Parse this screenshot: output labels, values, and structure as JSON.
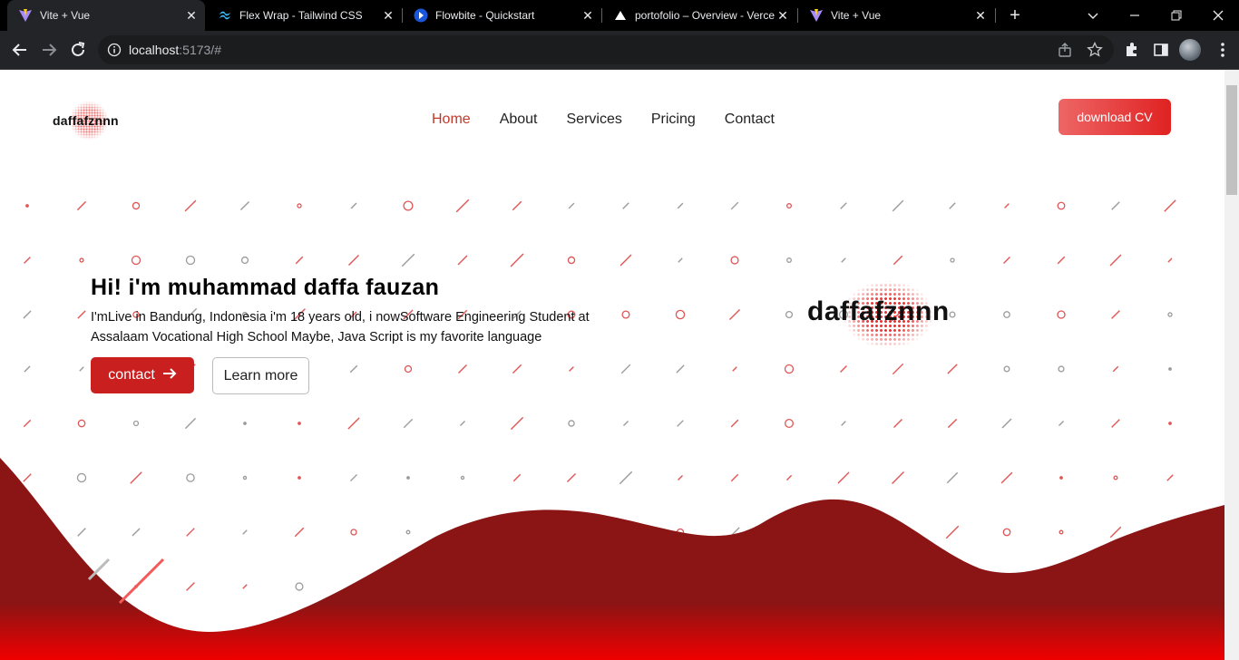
{
  "browser": {
    "tabs": [
      {
        "title": "Vite + Vue",
        "icon": "vite-icon",
        "active": true
      },
      {
        "title": "Flex Wrap - Tailwind CSS",
        "icon": "tailwind-icon",
        "active": false
      },
      {
        "title": "Flowbite - Quickstart",
        "icon": "flowbite-icon",
        "active": false
      },
      {
        "title": "portofolio – Overview - Verce",
        "icon": "vercel-icon",
        "active": false
      },
      {
        "title": "Vite + Vue",
        "icon": "vite-icon",
        "active": false
      }
    ],
    "url_host": "localhost",
    "url_rest": ":5173/#"
  },
  "site": {
    "logo_text": "daffafznnn",
    "nav": [
      "Home",
      "About",
      "Services",
      "Pricing",
      "Contact"
    ],
    "cv_button": "download CV",
    "hero": {
      "title": "Hi! i'm muhammad daffa fauzan",
      "desc": "I'mLive in Bandung, Indonesia i'm 18 years old, i nowSoftware Engineering Student at Assalaam Vocational High School Maybe, Java Script is my favorite language",
      "contact_button": "contact",
      "learn_button": "Learn more"
    },
    "brand_logo_text": "daffafznnn"
  },
  "colors": {
    "accent": "#c91f1f",
    "wave_top": "#8b1414",
    "wave_bottom": "#f00000",
    "pattern_red": "#e05555",
    "pattern_gray": "#9a9a9a"
  }
}
